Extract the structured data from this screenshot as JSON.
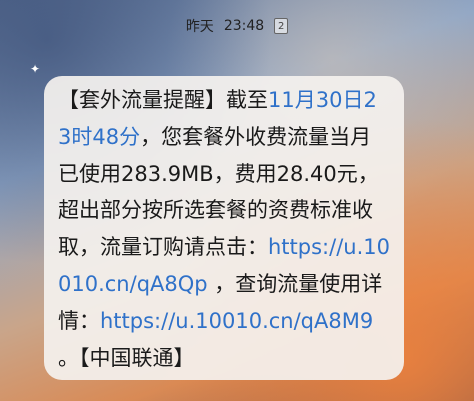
{
  "status": {
    "day": "昨天",
    "time": "23:48",
    "sim": "2"
  },
  "message": {
    "prefix": "【套外流量提醒】截至",
    "datetime": "11月30日23时48分",
    "body1": "，您套餐外收费流量当月已使用283.9MB，费用28.40元，超出部分按所选套餐的资费标准收取，流量订购请点击：",
    "link1": "https://u.10010.cn/qA8Qp",
    "body2": " ，查询流量使用详情：",
    "link2": "https://u.10010.cn/qA8M9",
    "body3": " 。【中国联通】"
  },
  "colors": {
    "link": "#2f71c9",
    "bubble": "#f4f1ee"
  }
}
